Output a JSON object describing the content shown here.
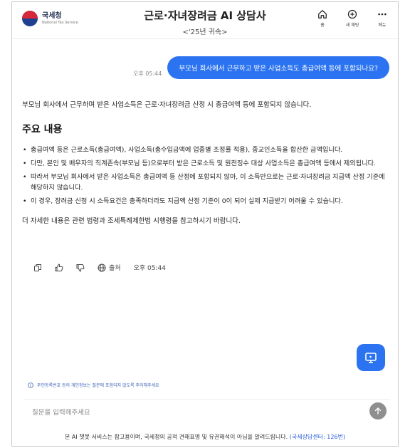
{
  "header": {
    "logo_text": "국세청",
    "logo_sub": "National Tax Service",
    "title": "근로·자녀장려금 AI 상담사",
    "subtitle": "<'25년 귀속>",
    "actions": [
      {
        "label": "홈",
        "icon": "home-icon"
      },
      {
        "label": "새 채팅",
        "icon": "new-chat-icon"
      },
      {
        "label": "메뉴",
        "icon": "more-icon"
      }
    ]
  },
  "chat": {
    "user_message": "부모님 회사에서 근무하고 받은 사업소득도 총급여액 등에 포함되나요?",
    "user_time": "오후 05:44",
    "answer": {
      "intro": "부모님 회사에서 근무하며 받은 사업소득은 근로·자녀장려금 산정 시 총급여액 등에 포함되지 않습니다.",
      "heading": "주요 내용",
      "bullets": [
        "총급여액 등은 근로소득(총급여액), 사업소득(총수입금액에 업종별 조정률 적용), 종교인소득을 합산한 금액입니다.",
        "다만, 본인 및 배우자의 직계존속(부모님 등)으로부터 받은 근로소득 및 원천징수 대상 사업소득은 총급여액 등에서 제외됩니다.",
        "따라서 부모님 회사에서 받은 사업소득은 총급여액 등 산정에 포함되지 않아, 이 소득만으로는 근로·자녀장려금 지급액 산정 기준에 해당하지 않습니다.",
        "이 경우, 장려금 신청 시 소득요건은 충족하더라도 지급액 산정 기준이 0이 되어 실제 지급받기 어려울 수 있습니다."
      ],
      "outro": "더 자세한 내용은 관련 법령과 조세특례제한법 시행령을 참고하시기 바랍니다."
    },
    "tools": {
      "source_label": "출처",
      "time": "오후 05:44"
    }
  },
  "notice": "주민등록번호 등의 개인정보는 질문에 포함되지 않도록 주의해주세요",
  "input": {
    "placeholder": "질문을 입력해주세요"
  },
  "footer": {
    "text": "본 AI 챗봇 서비스는 참고용이며, 국세청의 공적 견해표명 및 유권해석이 아님을 알려드립니다.",
    "link": "(국세상담센터: 126번)"
  },
  "colors": {
    "accent": "#2b73f0",
    "send_button": "#8f8f8f",
    "notice": "#3b63b8"
  }
}
